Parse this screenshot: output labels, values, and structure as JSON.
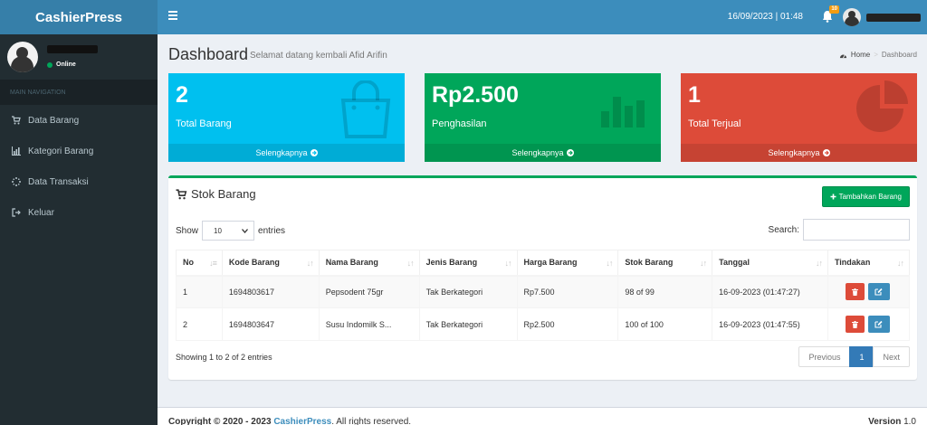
{
  "app": {
    "brand": "CashierPress"
  },
  "header": {
    "datetime": "16/09/2023 | 01:48",
    "notif_count": "10"
  },
  "sidebar": {
    "status": "Online",
    "nav_header": "MAIN NAVIGATION",
    "items": [
      {
        "label": "Data Barang",
        "icon": "cart-icon"
      },
      {
        "label": "Kategori Barang",
        "icon": "bar-chart-icon"
      },
      {
        "label": "Data Transaksi",
        "icon": "spinner-icon"
      },
      {
        "label": "Keluar",
        "icon": "sign-out-icon"
      }
    ]
  },
  "page": {
    "title": "Dashboard",
    "subtitle": "Selamat datang kembali Afid Arifin",
    "breadcrumb": {
      "home": "Home",
      "current": "Dashboard"
    }
  },
  "stats": [
    {
      "value": "2",
      "label": "Total Barang",
      "link": "Selengkapnya",
      "color": "#00c0ef",
      "icon": "shopping-bag-icon"
    },
    {
      "value": "Rp2.500",
      "label": "Penghasilan",
      "link": "Selengkapnya",
      "color": "#00a65a",
      "icon": "bar-chart-icon"
    },
    {
      "value": "1",
      "label": "Total Terjual",
      "link": "Selengkapnya",
      "color": "#dd4b39",
      "icon": "pie-chart-icon"
    }
  ],
  "stock_box": {
    "title": "Stok Barang",
    "add_button": "Tambahkan Barang",
    "show_label": "Show",
    "entries_label": "entries",
    "page_length": "10",
    "search_label": "Search:",
    "search_value": "",
    "columns": [
      "No",
      "Kode Barang",
      "Nama Barang",
      "Jenis Barang",
      "Harga Barang",
      "Stok Barang",
      "Tanggal",
      "Tindakan"
    ],
    "rows": [
      {
        "no": "1",
        "kode": "1694803617",
        "nama": "Pepsodent 75gr",
        "jenis": "Tak Berkategori",
        "harga": "Rp7.500",
        "stok": "98 of 99",
        "tanggal": "16-09-2023 (01:47:27)"
      },
      {
        "no": "2",
        "kode": "1694803647",
        "nama": "Susu Indomilk S...",
        "jenis": "Tak Berkategori",
        "harga": "Rp2.500",
        "stok": "100 of 100",
        "tanggal": "16-09-2023 (01:47:55)"
      }
    ],
    "info": "Showing 1 to 2 of 2 entries",
    "pagination": {
      "previous": "Previous",
      "current": "1",
      "next": "Next"
    }
  },
  "footer": {
    "copyright_prefix": "Copyright © 2020 - 2023 ",
    "brand_link": "CashierPress",
    "copyright_suffix": ". All rights reserved.",
    "version_label": "Version",
    "version_number": " 1.0"
  }
}
